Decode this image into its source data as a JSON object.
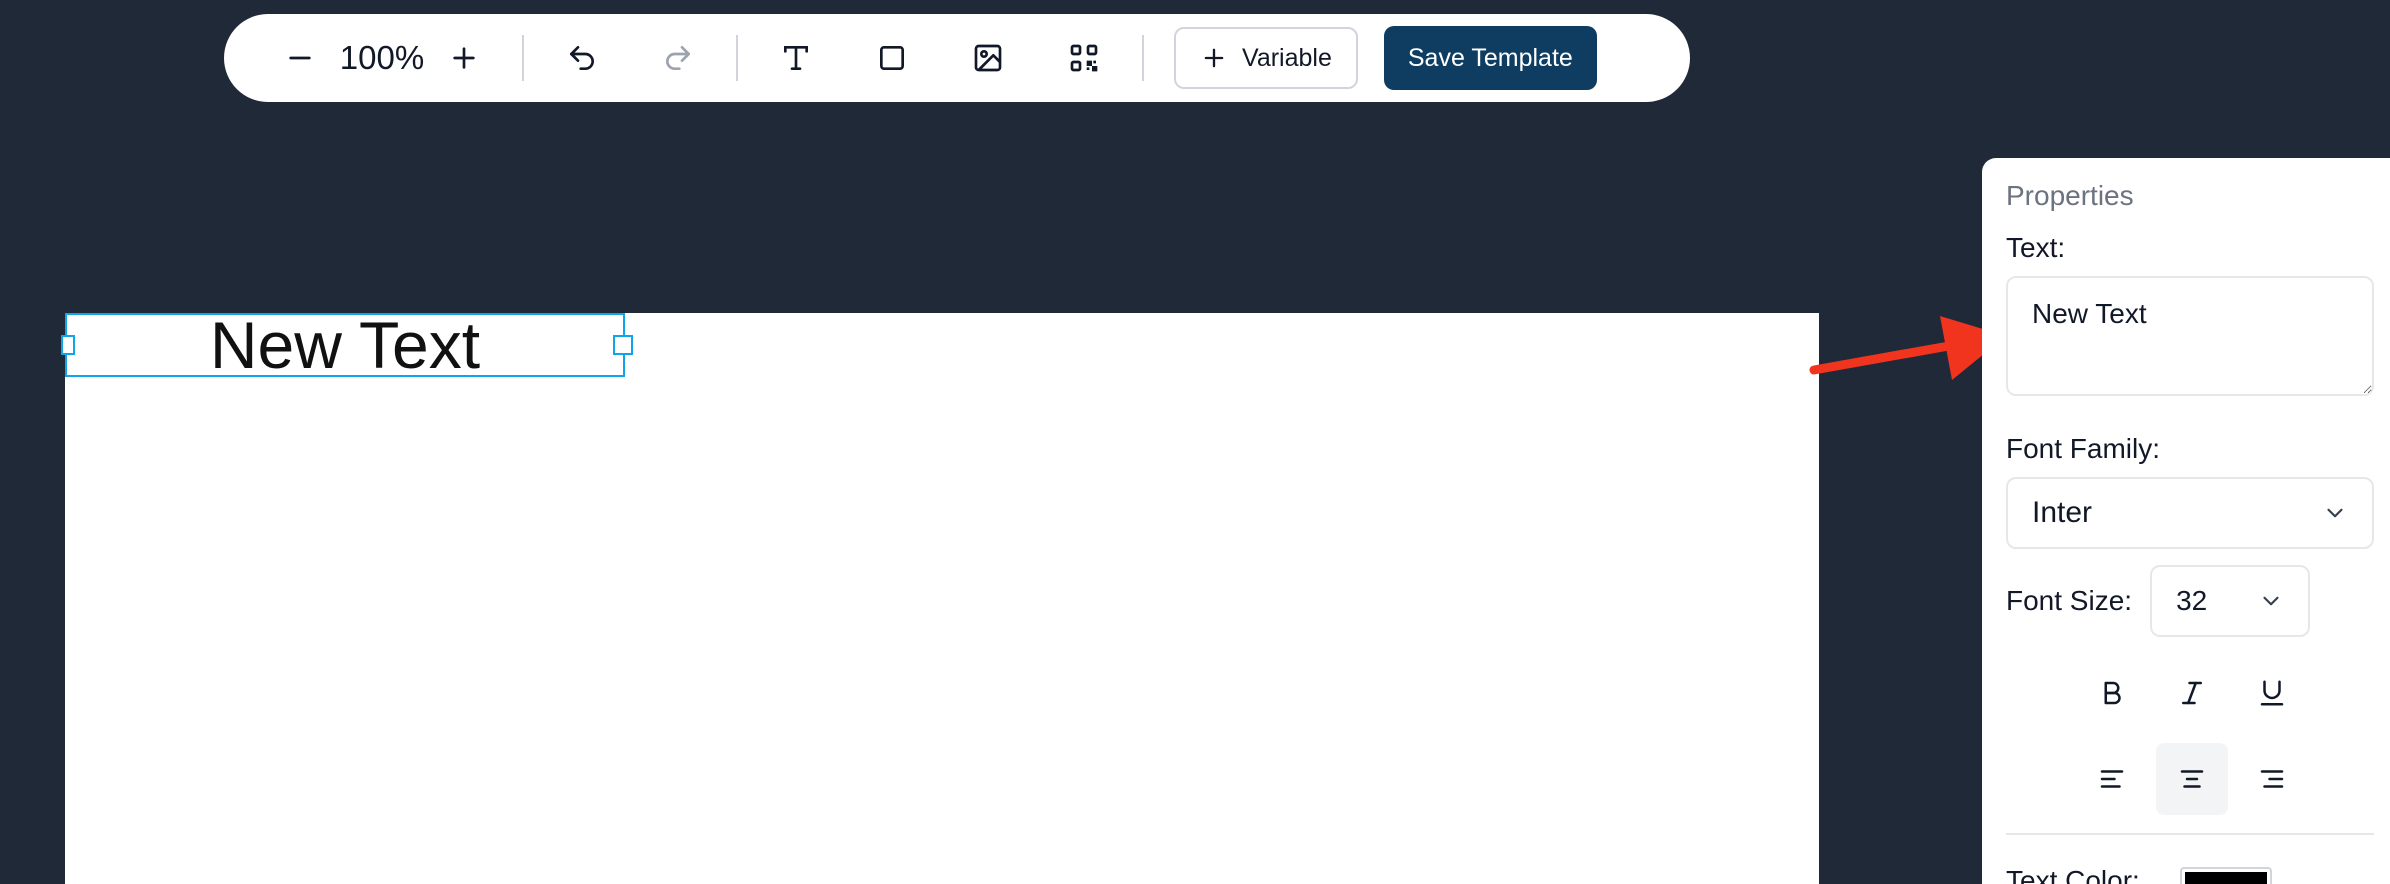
{
  "toolbar": {
    "zoom_level": "100%",
    "variable_label": "Variable",
    "save_label": "Save Template"
  },
  "canvas": {
    "text_element": "New Text"
  },
  "panel": {
    "title": "Properties",
    "text_label": "Text:",
    "text_value": "New Text",
    "font_family_label": "Font Family:",
    "font_family_value": "Inter",
    "font_size_label": "Font Size:",
    "font_size_value": "32",
    "text_color_label": "Text Color:",
    "text_color_value": "#000000",
    "active_alignment": "center"
  },
  "colors": {
    "background": "#1f2937",
    "primary": "#0f3d62",
    "selection": "#0ea5e9",
    "annotation_arrow": "#f0341d"
  }
}
